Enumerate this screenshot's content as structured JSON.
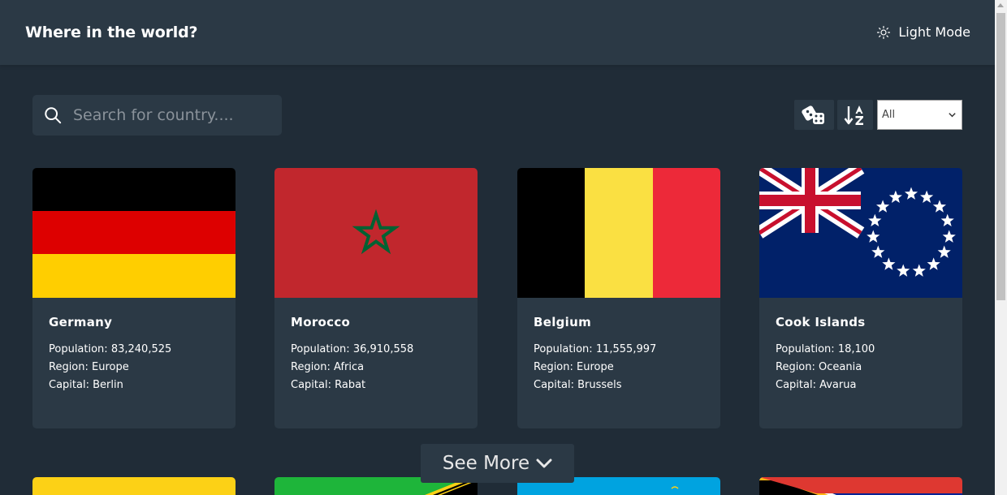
{
  "header": {
    "title": "Where in the world?",
    "mode_label": "Light Mode"
  },
  "search": {
    "placeholder": "Search for country...."
  },
  "toolbar": {
    "random_icon": "dice-icon",
    "sort_icon": "sort-az-icon",
    "region_filter": {
      "selected": "All"
    }
  },
  "countries": [
    {
      "name": "Germany",
      "population_label": "Population:",
      "population": "83,240,525",
      "region_label": "Region:",
      "region": "Europe",
      "capital_label": "Capital:",
      "capital": "Berlin"
    },
    {
      "name": "Morocco",
      "population_label": "Population:",
      "population": "36,910,558",
      "region_label": "Region:",
      "region": "Africa",
      "capital_label": "Capital:",
      "capital": "Rabat"
    },
    {
      "name": "Belgium",
      "population_label": "Population:",
      "population": "11,555,997",
      "region_label": "Region:",
      "region": "Europe",
      "capital_label": "Capital:",
      "capital": "Brussels"
    },
    {
      "name": "Cook Islands",
      "population_label": "Population:",
      "population": "18,100",
      "region_label": "Region:",
      "region": "Oceania",
      "capital_label": "Capital:",
      "capital": "Avarua"
    }
  ],
  "see_more": {
    "label": "See More"
  },
  "colors": {
    "background": "#202c37",
    "surface": "#2b3945",
    "text": "#ffffff"
  }
}
